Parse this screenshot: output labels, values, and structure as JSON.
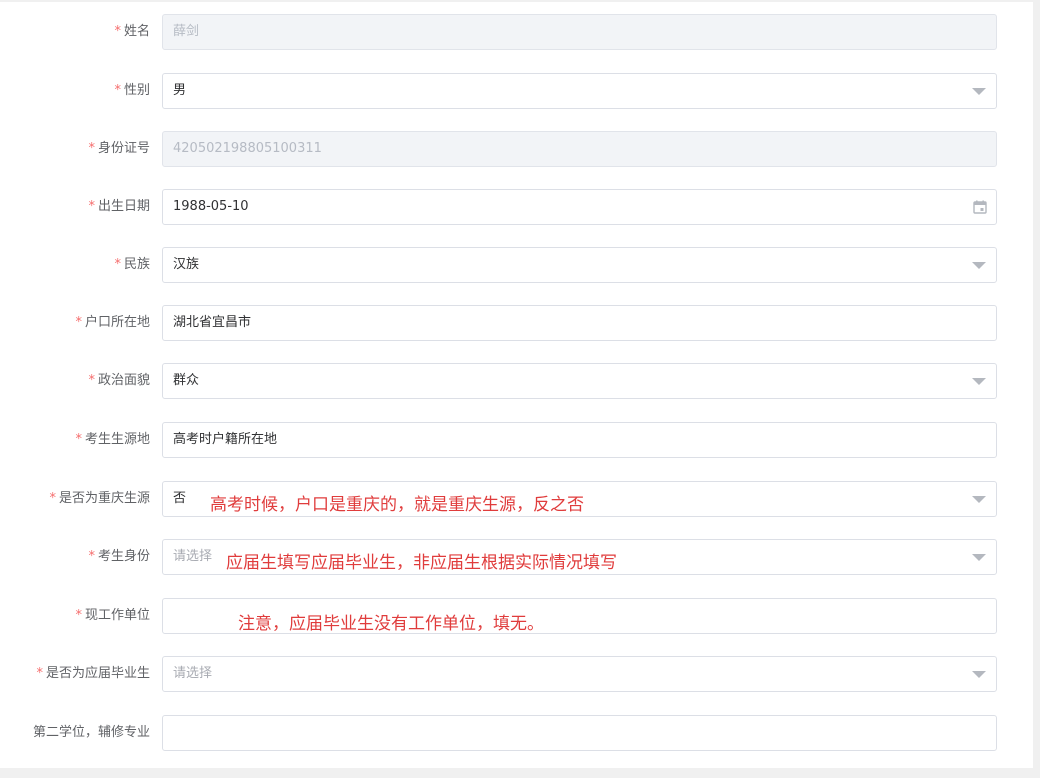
{
  "form": {
    "required_mark": "*",
    "rows": [
      {
        "label": "姓名",
        "value": "薛剑"
      },
      {
        "label": "性别",
        "value": "男"
      },
      {
        "label": "身份证号",
        "value": "420502198805100311"
      },
      {
        "label": "出生日期",
        "value": "1988-05-10"
      },
      {
        "label": "民族",
        "value": "汉族"
      },
      {
        "label": "户口所在地",
        "value": "湖北省宜昌市"
      },
      {
        "label": "政治面貌",
        "value": "群众"
      },
      {
        "label": "考生生源地",
        "value": "高考时户籍所在地"
      },
      {
        "label": "是否为重庆生源",
        "value": "否",
        "note": "高考时候，户口是重庆的，就是重庆生源，反之否"
      },
      {
        "label": "考生身份",
        "placeholder": "请选择",
        "note": "应届生填写应届毕业生，非应届生根据实际情况填写"
      },
      {
        "label": "现工作单位",
        "value": "",
        "note": "注意，应届毕业生没有工作单位，填无。"
      },
      {
        "label": "是否为应届毕业生",
        "placeholder": "请选择"
      },
      {
        "label": "第二学位，辅修专业",
        "value": ""
      }
    ]
  },
  "icons": {
    "select": "chevron-down-icon",
    "date": "calendar-icon"
  },
  "colors": {
    "required": "#f56c6c",
    "note": "#e03c3c",
    "disabled_bg": "#f2f4f7",
    "border": "#dcdfe6"
  }
}
